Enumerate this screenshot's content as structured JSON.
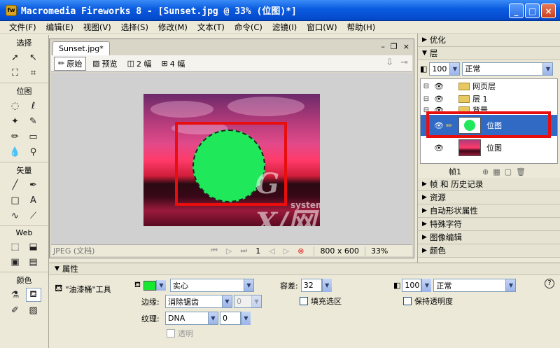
{
  "window": {
    "title": "Macromedia Fireworks 8 - [Sunset.jpg @  33% (位图)*]",
    "app_icon": "fw",
    "min_label": "_",
    "max_label": "□",
    "close_label": "×"
  },
  "menu": {
    "items": [
      "文件(F)",
      "编辑(E)",
      "视图(V)",
      "选择(S)",
      "修改(M)",
      "文本(T)",
      "命令(C)",
      "滤镜(I)",
      "窗口(W)",
      "帮助(H)"
    ]
  },
  "tools": {
    "sections": [
      "选择",
      "位图",
      "矢量",
      "Web",
      "颜色"
    ],
    "select_tools": [
      "pointer-icon",
      "subselect-icon",
      "scale-icon",
      "crop-icon"
    ],
    "bitmap_tools": [
      "marquee-icon",
      "lasso-icon",
      "magic-wand-icon",
      "brush-icon",
      "pencil-icon",
      "eraser-icon",
      "blur-icon",
      "rubber-stamp-icon"
    ],
    "vector_tools": [
      "line-icon",
      "pen-icon",
      "rectangle-icon",
      "text-icon",
      "freeform-icon",
      "knife-icon"
    ],
    "web_tools": [
      "hotspot-icon",
      "slice-icon",
      "hide-slices-icon",
      "show-slices-icon"
    ],
    "color_tools": [
      "eyedropper-icon",
      "paint-bucket-icon",
      "stroke-color-icon",
      "fill-color-icon"
    ]
  },
  "document": {
    "tab": "Sunset.jpg*",
    "view_tabs": [
      "原始",
      "预览",
      "2 幅",
      "4 幅"
    ],
    "status_format": "JPEG (文档)",
    "frame": "1",
    "size": "800 x 600",
    "zoom": "33%",
    "watermark": "G X/网",
    "watermark_sub": "system.com",
    "fill_color": "#1fe85a",
    "highlight_color": "#e80e0e"
  },
  "panels": {
    "optimize": "优化",
    "layers": "层",
    "opacity": "100",
    "blend": "正常",
    "layer_rows": [
      {
        "name": "网页层"
      },
      {
        "name": "层 1"
      },
      {
        "name": "背景"
      },
      {
        "name": "位图"
      },
      {
        "name": "位图"
      }
    ],
    "frame_label": "帧1",
    "collapsed": [
      "帧 和 历史记录",
      "资源",
      "自动形状属性",
      "特殊字符",
      "图像编辑",
      "颜色"
    ]
  },
  "properties": {
    "header": "属性",
    "tool_name": "\"油漆桶\"工具",
    "fill_type": "实心",
    "edge_label": "边缘:",
    "edge_value": "消除锯齿",
    "edge_amount": "0",
    "texture_label": "纹理:",
    "texture_value": "DNA",
    "texture_amount": "0",
    "transparent_label": "透明",
    "tolerance_label": "容差:",
    "tolerance_value": "32",
    "fill_selection_label": "填充选区",
    "opacity_value": "100",
    "blend_value": "正常",
    "preserve_label": "保持透明度",
    "help_label": "?"
  }
}
